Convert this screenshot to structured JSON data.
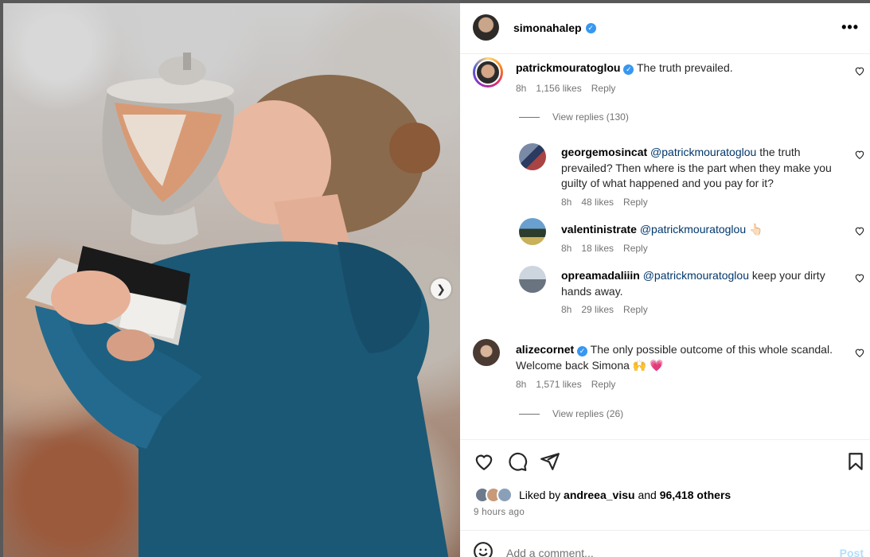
{
  "post": {
    "author": "simonahalep",
    "author_verified": true,
    "more_icon": "more-icon"
  },
  "comments": [
    {
      "username": "patrickmouratoglou",
      "verified": true,
      "text": "The truth prevailed.",
      "time": "8h",
      "likes": "1,156 likes",
      "reply": "Reply",
      "view_replies": "View replies (130)"
    },
    {
      "username": "georgemosincat",
      "mention": "@patrickmouratoglou",
      "text": " the truth prevailed? Then where is the part when they make you guilty of what happened and you pay for it?",
      "time": "8h",
      "likes": "48 likes",
      "reply": "Reply"
    },
    {
      "username": "valentinistrate",
      "mention": "@patrickmouratoglou",
      "text": " 👆🏻",
      "time": "8h",
      "likes": "18 likes",
      "reply": "Reply"
    },
    {
      "username": "opreamadaliiin",
      "mention": "@patrickmouratoglou",
      "text": " keep your dirty hands away.",
      "time": "8h",
      "likes": "29 likes",
      "reply": "Reply"
    },
    {
      "username": "alizecornet",
      "verified": true,
      "text": "The only possible outcome of this whole scandal. Welcome back Simona 🙌 💗",
      "time": "8h",
      "likes": "1,571 likes",
      "reply": "Reply",
      "view_replies": "View replies (26)"
    }
  ],
  "liked_by": {
    "prefix": "Liked by",
    "user": "andreea_visu",
    "and": "and",
    "others": "96,418 others"
  },
  "timestamp": "9 hours ago",
  "composer": {
    "placeholder": "Add a comment...",
    "post_label": "Post"
  },
  "colors": {
    "accent": "#3897f0",
    "mention": "#00376b",
    "muted": "#737373",
    "post_disabled": "#b2dffc"
  }
}
